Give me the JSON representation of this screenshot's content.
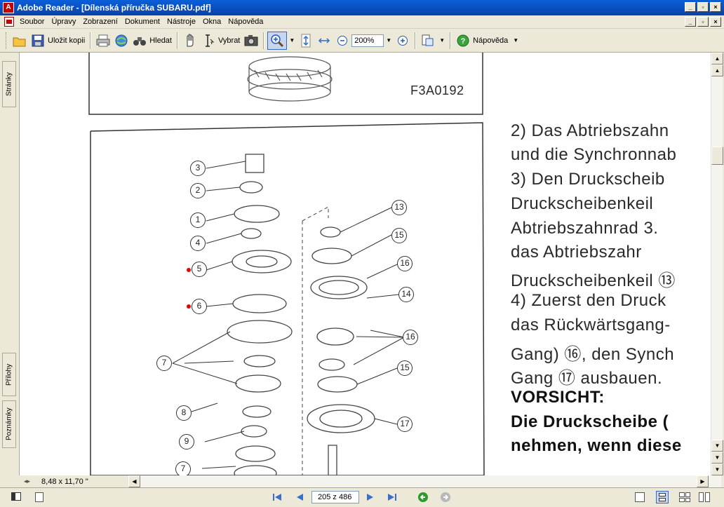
{
  "window": {
    "title": "Adobe Reader - [Dílenská příručka SUBARU.pdf]",
    "app_icon_label": "A",
    "buttons": [
      "_",
      "▫",
      "×"
    ]
  },
  "menu": [
    "Soubor",
    "Úpravy",
    "Zobrazení",
    "Dokument",
    "Nástroje",
    "Okna",
    "Nápověda"
  ],
  "toolbar": {
    "save_copy_label": "Uložit kopii",
    "search_label": "Hledat",
    "select_label": "Vybrat",
    "zoom_value": "200%",
    "help_label": "Nápověda"
  },
  "side_tabs": {
    "pages": "Stránky",
    "attachments": "Přílohy",
    "comments": "Poznámky"
  },
  "document": {
    "figure_code": "F3A0192",
    "text_lines": [
      "2) Das Abtriebszahn",
      "und die Synchronnab",
      "3) Den Druckscheib",
      "Druckscheibenkeil",
      "Abtriebszahnrad 3.",
      "das   Abtriebszahr",
      "Druckscheibenkeil ⑬",
      "4) Zuerst den Druck",
      "das Rückwärtsgang-",
      "Gang) ⑯, den Synch",
      "Gang ⑰ ausbauen."
    ],
    "caution_title": "VORSICHT:",
    "caution_lines": [
      "Die Druckscheibe (",
      "nehmen, wenn diese"
    ],
    "callouts_left": [
      "3",
      "2",
      "1",
      "4",
      "5",
      "6",
      "7",
      "8",
      "9",
      "7"
    ],
    "callouts_right": [
      "13",
      "15",
      "16",
      "14",
      "16",
      "15",
      "17"
    ]
  },
  "hbar": {
    "page_size": "8,48 x 11,70 \""
  },
  "status": {
    "page_indicator": "205 z 486"
  },
  "colors": {
    "titlebar": "#0a5fd8",
    "chrome": "#ece9d8",
    "nav_blue": "#3a6ec8",
    "nav_green": "#2e9a2e"
  }
}
